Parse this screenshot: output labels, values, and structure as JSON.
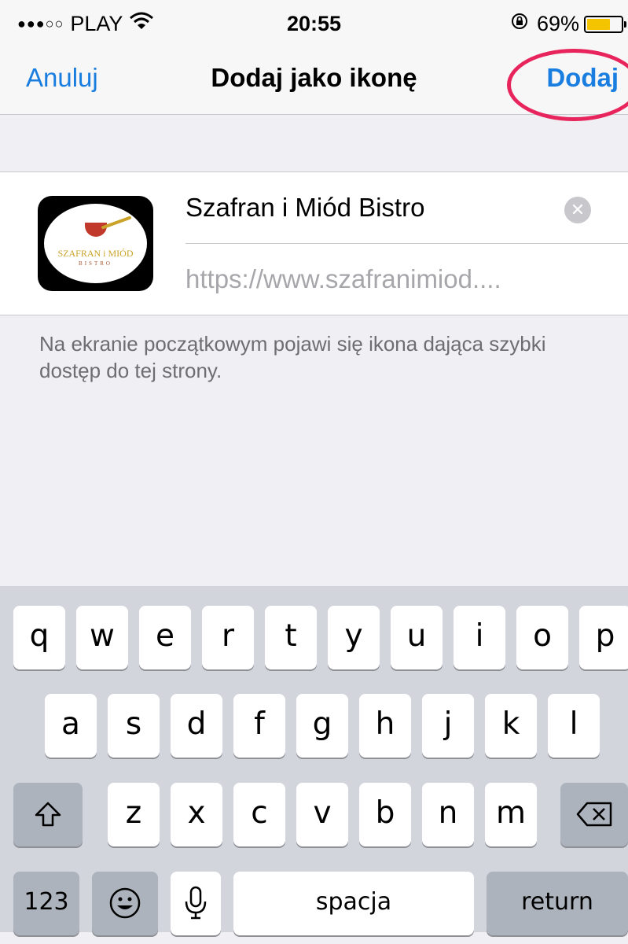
{
  "status_bar": {
    "carrier": "PLAY",
    "time": "20:55",
    "battery_percent": "69%",
    "battery_level": 0.69,
    "signal_dots": "●●●○○",
    "icons": [
      "wifi-icon",
      "rotation-lock-icon",
      "battery-icon"
    ]
  },
  "nav": {
    "cancel_label": "Anuluj",
    "title": "Dodaj jako ikonę",
    "add_label": "Dodaj"
  },
  "form": {
    "name_value": "Szafran i Miód Bistro",
    "url_value": "https://www.szafranimiod....",
    "icon_text": "SZAFRAN i MIÓD",
    "icon_subtext": "BISTRO"
  },
  "footer_note": "Na ekranie początkowym pojawi się ikona dająca szybki dostęp do tej strony.",
  "keyboard": {
    "row1": [
      "q",
      "w",
      "e",
      "r",
      "t",
      "y",
      "u",
      "i",
      "o",
      "p"
    ],
    "row2": [
      "a",
      "s",
      "d",
      "f",
      "g",
      "h",
      "j",
      "k",
      "l"
    ],
    "row3": [
      "z",
      "x",
      "c",
      "v",
      "b",
      "n",
      "m"
    ],
    "numbers_label": "123",
    "space_label": "spacja",
    "return_label": "return"
  },
  "colors": {
    "accent": "#1a7ee0",
    "annotation": "#e8245c",
    "battery": "#f5c400"
  }
}
